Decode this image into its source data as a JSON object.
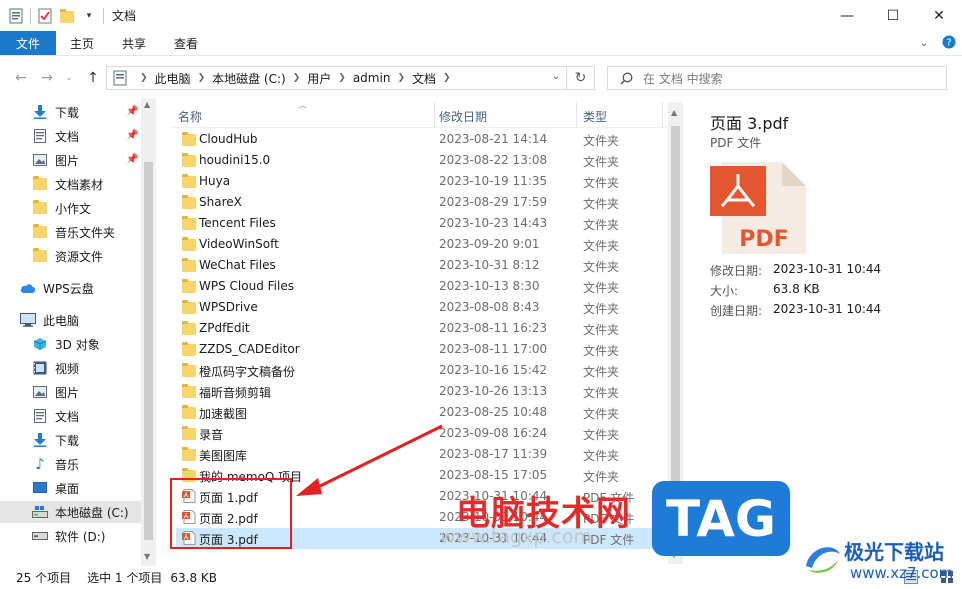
{
  "window": {
    "title": "文档"
  },
  "ribbon": {
    "tabs": [
      "文件",
      "主页",
      "共享",
      "查看"
    ]
  },
  "address": {
    "crumbs": [
      "此电脑",
      "本地磁盘 (C:)",
      "用户",
      "admin",
      "文档"
    ]
  },
  "search": {
    "placeholder": "在 文档 中搜索"
  },
  "nav": {
    "quick": [
      {
        "label": "下载",
        "icon": "download-arrow-icon",
        "pinned": true
      },
      {
        "label": "文档",
        "icon": "document-icon",
        "pinned": true
      },
      {
        "label": "图片",
        "icon": "pictures-icon",
        "pinned": true
      },
      {
        "label": "文档素材",
        "icon": "folder-icon",
        "pinned": false
      },
      {
        "label": "小作文",
        "icon": "folder-icon",
        "pinned": false
      },
      {
        "label": "音乐文件夹",
        "icon": "folder-icon",
        "pinned": false
      },
      {
        "label": "资源文件",
        "icon": "folder-icon",
        "pinned": false
      }
    ],
    "wps": "WPS云盘",
    "pc": "此电脑",
    "pc_items": [
      {
        "label": "3D 对象",
        "icon": "3d-objects-icon"
      },
      {
        "label": "视频",
        "icon": "video-icon"
      },
      {
        "label": "图片",
        "icon": "pictures-icon"
      },
      {
        "label": "文档",
        "icon": "document-icon"
      },
      {
        "label": "下载",
        "icon": "download-arrow-icon"
      },
      {
        "label": "音乐",
        "icon": "music-note-icon"
      },
      {
        "label": "桌面",
        "icon": "desktop-icon"
      },
      {
        "label": "本地磁盘 (C:)",
        "icon": "drive-c-icon",
        "selected": true
      },
      {
        "label": "软件 (D:)",
        "icon": "drive-icon"
      }
    ]
  },
  "columns": {
    "name": "名称",
    "date": "修改日期",
    "type": "类型"
  },
  "files": [
    {
      "name": "CloudHub",
      "date": "2023-08-21 14:14",
      "type": "文件夹",
      "kind": "folder"
    },
    {
      "name": "houdini15.0",
      "date": "2023-08-22 13:08",
      "type": "文件夹",
      "kind": "folder"
    },
    {
      "name": "Huya",
      "date": "2023-10-19 11:35",
      "type": "文件夹",
      "kind": "folder"
    },
    {
      "name": "ShareX",
      "date": "2023-08-29 17:59",
      "type": "文件夹",
      "kind": "folder"
    },
    {
      "name": "Tencent Files",
      "date": "2023-10-23 14:43",
      "type": "文件夹",
      "kind": "folder"
    },
    {
      "name": "VideoWinSoft",
      "date": "2023-09-20 9:01",
      "type": "文件夹",
      "kind": "folder"
    },
    {
      "name": "WeChat Files",
      "date": "2023-10-31 8:12",
      "type": "文件夹",
      "kind": "folder"
    },
    {
      "name": "WPS Cloud Files",
      "date": "2023-10-13 8:30",
      "type": "文件夹",
      "kind": "folder"
    },
    {
      "name": "WPSDrive",
      "date": "2023-08-08 8:43",
      "type": "文件夹",
      "kind": "folder"
    },
    {
      "name": "ZPdfEdit",
      "date": "2023-08-11 16:23",
      "type": "文件夹",
      "kind": "folder"
    },
    {
      "name": "ZZDS_CADEditor",
      "date": "2023-08-11 17:00",
      "type": "文件夹",
      "kind": "folder"
    },
    {
      "name": "橙瓜码字文稿备份",
      "date": "2023-10-16 15:42",
      "type": "文件夹",
      "kind": "folder"
    },
    {
      "name": "福昕音频剪辑",
      "date": "2023-10-26 13:13",
      "type": "文件夹",
      "kind": "folder"
    },
    {
      "name": "加速截图",
      "date": "2023-08-25 10:48",
      "type": "文件夹",
      "kind": "folder"
    },
    {
      "name": "录音",
      "date": "2023-09-08 16:24",
      "type": "文件夹",
      "kind": "folder"
    },
    {
      "name": "美图图库",
      "date": "2023-08-17 11:39",
      "type": "文件夹",
      "kind": "folder"
    },
    {
      "name": "我的 memoQ 项目",
      "date": "2023-08-15 17:05",
      "type": "文件夹",
      "kind": "folder"
    },
    {
      "name": "页面 1.pdf",
      "date": "2023-10-31 10:44",
      "type": "PDF 文件",
      "kind": "pdf"
    },
    {
      "name": "页面 2.pdf",
      "date": "2023-10-31 10:44",
      "type": "PDF 文件",
      "kind": "pdf"
    },
    {
      "name": "页面 3.pdf",
      "date": "2023-10-31 10:44",
      "type": "PDF 文件",
      "kind": "pdf",
      "selected": true
    }
  ],
  "preview": {
    "title": "页面 3.pdf",
    "subtitle": "PDF 文件",
    "pdf_label": "PDF",
    "props": [
      {
        "k": "修改日期:",
        "v": "2023-10-31 10:44"
      },
      {
        "k": "大小:",
        "v": "63.8 KB"
      },
      {
        "k": "创建日期:",
        "v": "2023-10-31 10:44"
      }
    ]
  },
  "status": {
    "count": "25 个项目",
    "selected": "选中 1 个项目",
    "size": "63.8 KB"
  },
  "overlay": {
    "watermark_cn": "电脑技术网",
    "watermark_url": "www.tagxp.com",
    "badge": "TAG",
    "logo_text": "极光下载站",
    "logo_url": "www.xz7.com"
  },
  "colors": {
    "accent": "#1979ca",
    "selection": "#cce8ff",
    "annotation": "#e52020",
    "folder": "#f7d46c",
    "pdf": "#e4572e"
  }
}
